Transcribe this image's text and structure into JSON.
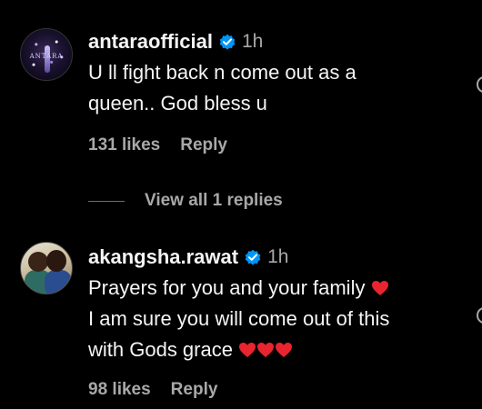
{
  "comments": [
    {
      "avatar_logo": "ANTARA",
      "username": "antaraofficial",
      "verified": true,
      "time": "1h",
      "lines": [
        "U ll fight back n come out as a",
        "queen.. God bless u"
      ],
      "likes": "131 likes",
      "reply_label": "Reply"
    },
    {
      "username": "akangsha.rawat",
      "verified": true,
      "time": "1h",
      "lines": [
        "Prayers for you and your family",
        "I am sure you will come out of this",
        "with Gods grace"
      ],
      "likes": "98 likes",
      "reply_label": "Reply"
    }
  ],
  "view_replies_label": "View all 1 replies",
  "icons": {
    "verified": "verified-badge-icon",
    "heart_emoji": "red-heart-emoji",
    "like": "heart-outline-icon"
  },
  "colors": {
    "background": "#000000",
    "text": "#f5f5f5",
    "secondary_text": "#a8a8a8",
    "verified_blue": "#0095f6",
    "heart_red": "#e8242f"
  }
}
